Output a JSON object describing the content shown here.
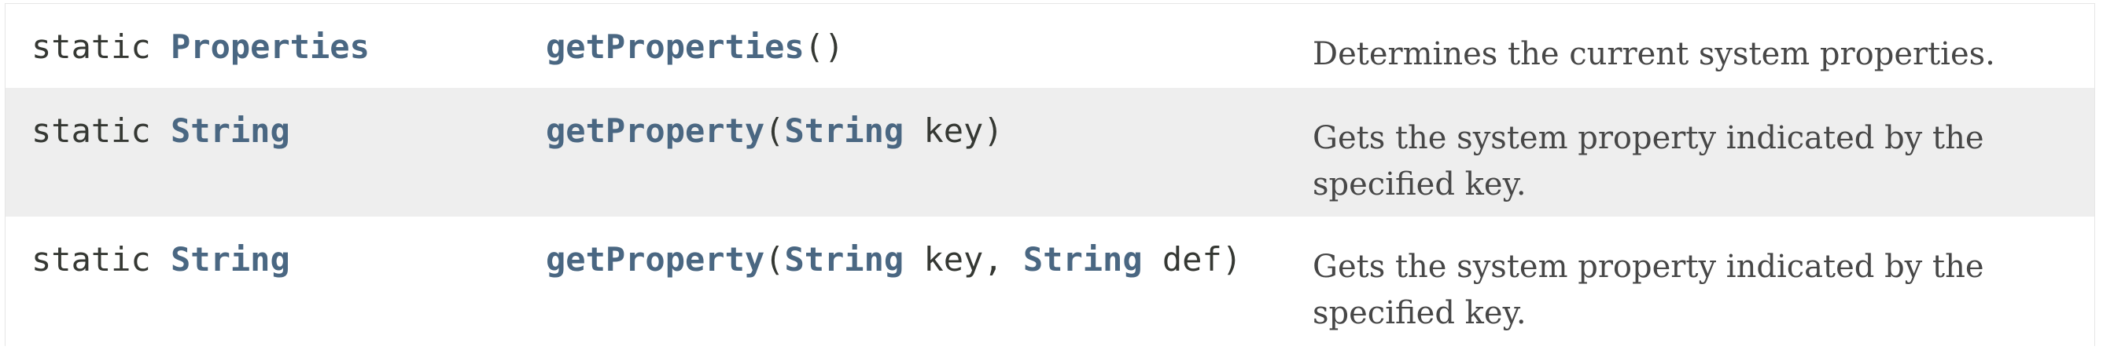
{
  "rows": [
    {
      "modifier": "static",
      "return_type": "Properties",
      "method_name": "getProperties",
      "params_open": "()",
      "description": "Determines the current system properties."
    },
    {
      "modifier": "static",
      "return_type": "String",
      "method_name": "getProperty",
      "paren_open": "(",
      "param1_type": "String",
      "param1_name": " key)",
      "description": "Gets the system property indicated by the specified key."
    },
    {
      "modifier": "static",
      "return_type": "String",
      "method_name": "getProperty",
      "paren_open": "(",
      "param1_type": "String",
      "param1_name": " key, ",
      "param2_type": "String",
      "param2_name": " def)",
      "description": "Gets the system property indicated by the specified key."
    }
  ],
  "colors": {
    "link": "#4a6782",
    "text": "#353833",
    "description": "#474747",
    "alt_row_bg": "#eeeeee"
  }
}
